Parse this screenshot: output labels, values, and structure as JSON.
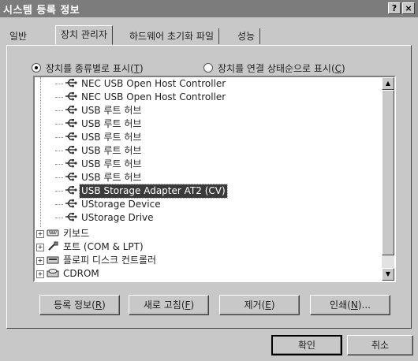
{
  "window": {
    "title": "시스템 등록 정보"
  },
  "titlebar_buttons": {
    "help": "?",
    "close": "×"
  },
  "tabs": [
    {
      "label": "일반"
    },
    {
      "label": "장치 관리자"
    },
    {
      "label": "하드웨어 초기화 파일"
    },
    {
      "label": "성능"
    }
  ],
  "view_options": {
    "by_type": {
      "label": "장치를 종류별로 표시",
      "key": "T",
      "selected": true
    },
    "by_connection": {
      "label": "장치를 연결 상태순으로 표시",
      "key": "C",
      "selected": false
    }
  },
  "tree": {
    "children": [
      {
        "label": "NEC USB Open Host Controller",
        "icon": "usb-icon"
      },
      {
        "label": "NEC USB Open Host Controller",
        "icon": "usb-icon"
      },
      {
        "label": "USB 루트 허브",
        "icon": "usb-icon"
      },
      {
        "label": "USB 루트 허브",
        "icon": "usb-icon"
      },
      {
        "label": "USB 루트 허브",
        "icon": "usb-icon"
      },
      {
        "label": "USB 루트 허브",
        "icon": "usb-icon"
      },
      {
        "label": "USB 루트 허브",
        "icon": "usb-icon"
      },
      {
        "label": "USB 루트 허브",
        "icon": "usb-icon"
      },
      {
        "label": "USB Storage Adapter AT2 (CV)",
        "icon": "usb-icon",
        "selected": true
      },
      {
        "label": "UStorage Device",
        "icon": "usb-icon"
      },
      {
        "label": "UStorage Drive",
        "icon": "usb-icon"
      }
    ],
    "categories": [
      {
        "label": "키보드",
        "icon": "keyboard-icon"
      },
      {
        "label": "포트 (COM & LPT)",
        "icon": "port-icon"
      },
      {
        "label": "플로피 디스크 컨트롤러",
        "icon": "floppy-controller-icon"
      },
      {
        "label": "CDROM",
        "icon": "cdrom-icon"
      }
    ]
  },
  "buttons": {
    "properties": {
      "label": "등록 정보",
      "key": "R"
    },
    "refresh": {
      "label": "새로 고침",
      "key": "F"
    },
    "remove": {
      "label": "제거",
      "key": "E"
    },
    "print": {
      "label": "인쇄",
      "key": "N",
      "suffix": "..."
    }
  },
  "dialog_buttons": {
    "ok": "확인",
    "cancel": "취소"
  },
  "colors": {
    "selection": "#3a3a3a",
    "titlebar": "#7c7c7c",
    "face": "#c8c8c8"
  }
}
